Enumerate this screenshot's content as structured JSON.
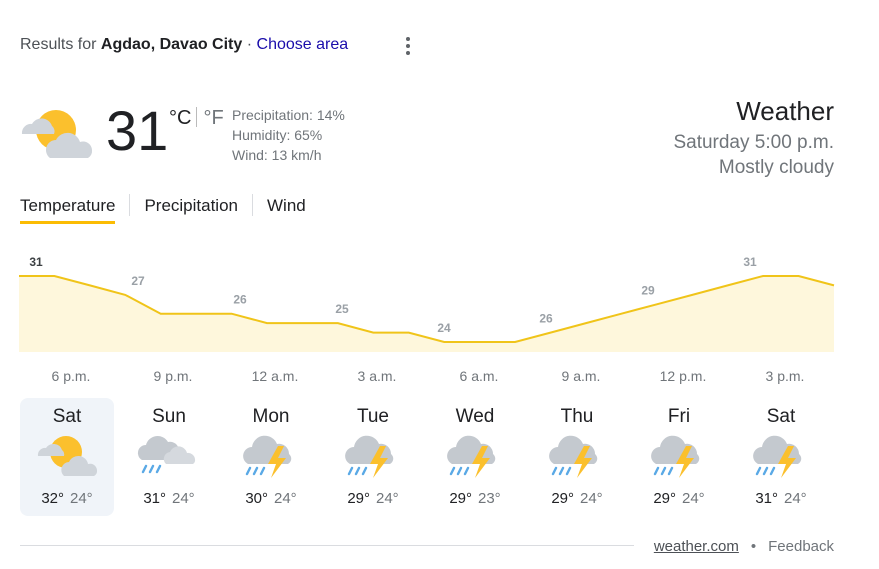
{
  "header": {
    "results_prefix": "Results for",
    "location": "Agdao, Davao City",
    "separator": "·",
    "choose_area": "Choose area"
  },
  "current": {
    "icon": "mostly-cloudy-icon",
    "temperature": "31",
    "unit_c": "°C",
    "unit_f": "°F",
    "precipitation": "Precipitation: 14%",
    "humidity": "Humidity: 65%",
    "wind": "Wind: 13 km/h",
    "title": "Weather",
    "datetime": "Saturday 5:00 p.m.",
    "condition": "Mostly cloudy"
  },
  "tabs": [
    "Temperature",
    "Precipitation",
    "Wind"
  ],
  "active_tab": "Temperature",
  "chart_data": {
    "type": "area",
    "title": "",
    "x": [
      "5 p.m.",
      "6 p.m.",
      "7 p.m.",
      "8 p.m.",
      "9 p.m.",
      "10 p.m.",
      "11 p.m.",
      "12 a.m.",
      "1 a.m.",
      "2 a.m.",
      "3 a.m.",
      "4 a.m.",
      "5 a.m.",
      "6 a.m.",
      "7 a.m.",
      "8 a.m.",
      "9 a.m.",
      "10 a.m.",
      "11 a.m.",
      "12 p.m.",
      "1 p.m.",
      "2 p.m.",
      "3 p.m.",
      "4 p.m."
    ],
    "values": [
      31,
      31,
      30,
      29,
      27,
      27,
      27,
      26,
      26,
      26,
      25,
      25,
      24,
      24,
      24,
      25,
      26,
      27,
      28,
      29,
      30,
      31,
      31,
      30
    ],
    "labels": [
      {
        "index": 0,
        "text": "31"
      },
      {
        "index": 3,
        "text": "27"
      },
      {
        "index": 6,
        "text": "26"
      },
      {
        "index": 9,
        "text": "25"
      },
      {
        "index": 12,
        "text": "24"
      },
      {
        "index": 15,
        "text": "26"
      },
      {
        "index": 18,
        "text": "29"
      },
      {
        "index": 21,
        "text": "31"
      }
    ],
    "tick_labels": [
      "6 p.m.",
      "9 p.m.",
      "12 a.m.",
      "3 a.m.",
      "6 a.m.",
      "9 a.m.",
      "12 p.m.",
      "3 p.m."
    ],
    "color_line": "#f0c419",
    "color_fill": "#fef7dc"
  },
  "forecast": [
    {
      "day": "Sat",
      "icon": "partly-sunny-icon",
      "high": "32°",
      "low": "24°"
    },
    {
      "day": "Sun",
      "icon": "showers-icon",
      "high": "31°",
      "low": "24°"
    },
    {
      "day": "Mon",
      "icon": "thunderstorm-icon",
      "high": "30°",
      "low": "24°"
    },
    {
      "day": "Tue",
      "icon": "thunderstorm-icon",
      "high": "29°",
      "low": "24°"
    },
    {
      "day": "Wed",
      "icon": "thunderstorm-icon",
      "high": "29°",
      "low": "23°"
    },
    {
      "day": "Thu",
      "icon": "thunderstorm-icon",
      "high": "29°",
      "low": "24°"
    },
    {
      "day": "Fri",
      "icon": "thunderstorm-icon",
      "high": "29°",
      "low": "24°"
    },
    {
      "day": "Sat",
      "icon": "thunderstorm-icon",
      "high": "31°",
      "low": "24°"
    }
  ],
  "footer": {
    "source": "weather.com",
    "dot": "•",
    "feedback": "Feedback"
  }
}
